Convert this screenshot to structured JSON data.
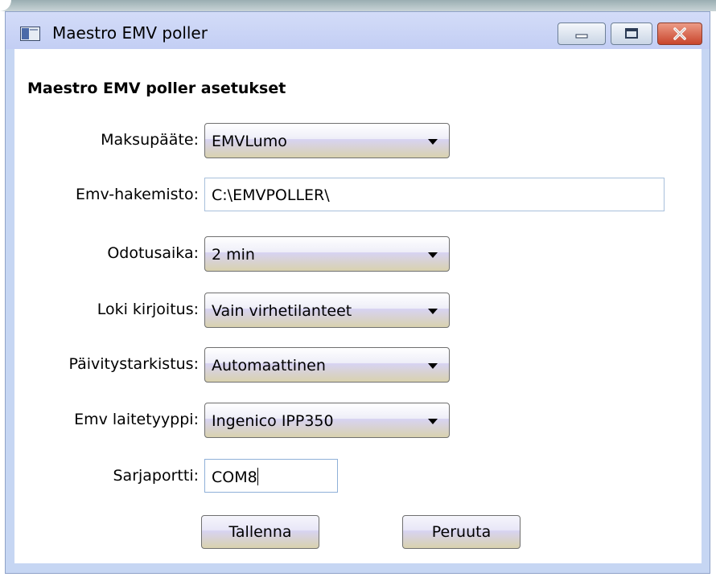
{
  "window": {
    "title": "Maestro EMV poller",
    "minimize_icon": "minimize-icon",
    "maximize_icon": "maximize-icon",
    "close_icon": "close-icon",
    "app_icon": "app-icon"
  },
  "form": {
    "heading": "Maestro EMV poller asetukset",
    "fields": {
      "terminal": {
        "label": "Maksupääte:",
        "value": "EMVLumo"
      },
      "emv_dir": {
        "label": "Emv-hakemisto:",
        "value": "C:\\EMVPOLLER\\"
      },
      "wait_time": {
        "label": "Odotusaika:",
        "value": "2 min"
      },
      "log_write": {
        "label": "Loki kirjoitus:",
        "value": "Vain virhetilanteet"
      },
      "update_check": {
        "label": "Päivitystarkistus:",
        "value": "Automaattinen"
      },
      "device_type": {
        "label": "Emv laitetyyppi:",
        "value": "Ingenico IPP350"
      },
      "serial_port": {
        "label": "Sarjaportti:",
        "value": "COM8"
      }
    },
    "buttons": {
      "save": "Tallenna",
      "cancel": "Peruuta"
    }
  },
  "colors": {
    "title_bar": "#c6d6f3",
    "close_button": "#c8452c",
    "control_gradient_bottom": "#d9d2ae",
    "textbox_border": "#a8c0dc"
  }
}
